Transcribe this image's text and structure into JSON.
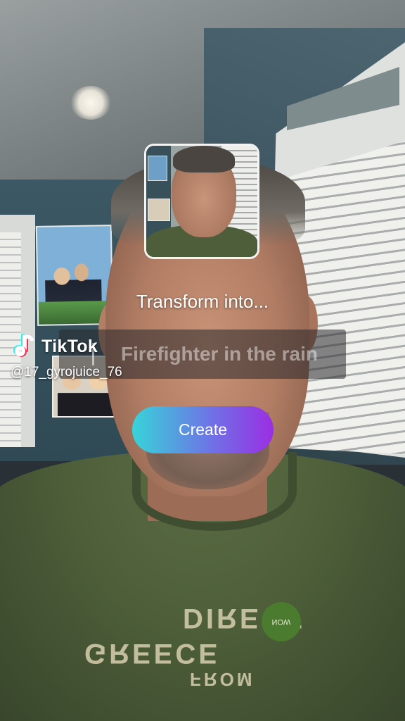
{
  "effect_overlay": {
    "prompt_heading": "Transform into...",
    "prompt_value": "Firefighter in the rain",
    "create_label": "Create",
    "create_gradient": [
      "#37d4d8",
      "#6d74e6",
      "#9b2ee3"
    ]
  },
  "watermark": {
    "brand": "TikTok",
    "handle": "@17_gyrojuice_76",
    "logo_icon": "tiktok-note-icon"
  },
  "scene": {
    "shirt_print_line1": "DIRECT",
    "shirt_print_line2": "GREECE",
    "shirt_print_line3": "FROM",
    "shirt_badge": "NOW"
  }
}
